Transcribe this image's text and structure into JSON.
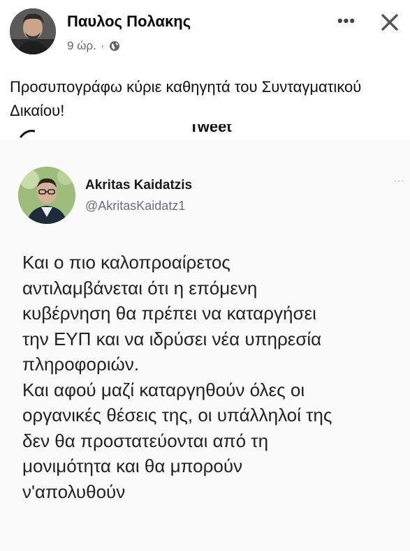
{
  "post": {
    "author": "Παυλος Πολακης",
    "time": "9 ώρ.",
    "separator": "·",
    "privacy_icon": "globe-icon",
    "more_label": "•••",
    "close_icon": "close-icon",
    "text": "Προσυπογράφω κύριε καθηγητά του Συνταγματικού Δικαίου!"
  },
  "tweet_fragment": {
    "label": "Tweet"
  },
  "tweet": {
    "name": "Akritas Kaidatzis",
    "handle": "@AkritasKaidatz1",
    "more_label": "···",
    "lines": [
      "Και ο πιο καλοπροαίρετος",
      "αντιλαμβάνεται ότι η επόμενη",
      "κυβέρνηση θα πρέπει να καταργήσει",
      "την ΕΥΠ και να ιδρύσει νέα υπηρεσία",
      "πληροφοριών.",
      "Και αφού μαζί καταργηθούν όλες οι",
      "οργανικές θέσεις της, οι υπάλληλοί της",
      "δεν θα προστατεύονται από τη",
      "μονιμότητα και θα μπορούν",
      "ν'απολυθούν"
    ]
  }
}
